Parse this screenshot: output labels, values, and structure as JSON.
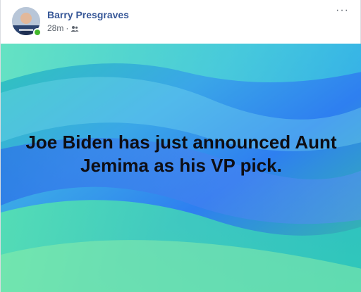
{
  "post": {
    "author_name": "Barry Presgraves",
    "timestamp": "28m",
    "separator": "·",
    "audience_icon": "friends-icon",
    "more_icon": "more-options-icon",
    "more_glyph": "···",
    "online_status": "online",
    "text": "Joe Biden has just announced Aunt Jemima as his VP pick."
  },
  "colors": {
    "author_link": "#385898",
    "meta_text": "#606770",
    "online": "#42b72a"
  }
}
